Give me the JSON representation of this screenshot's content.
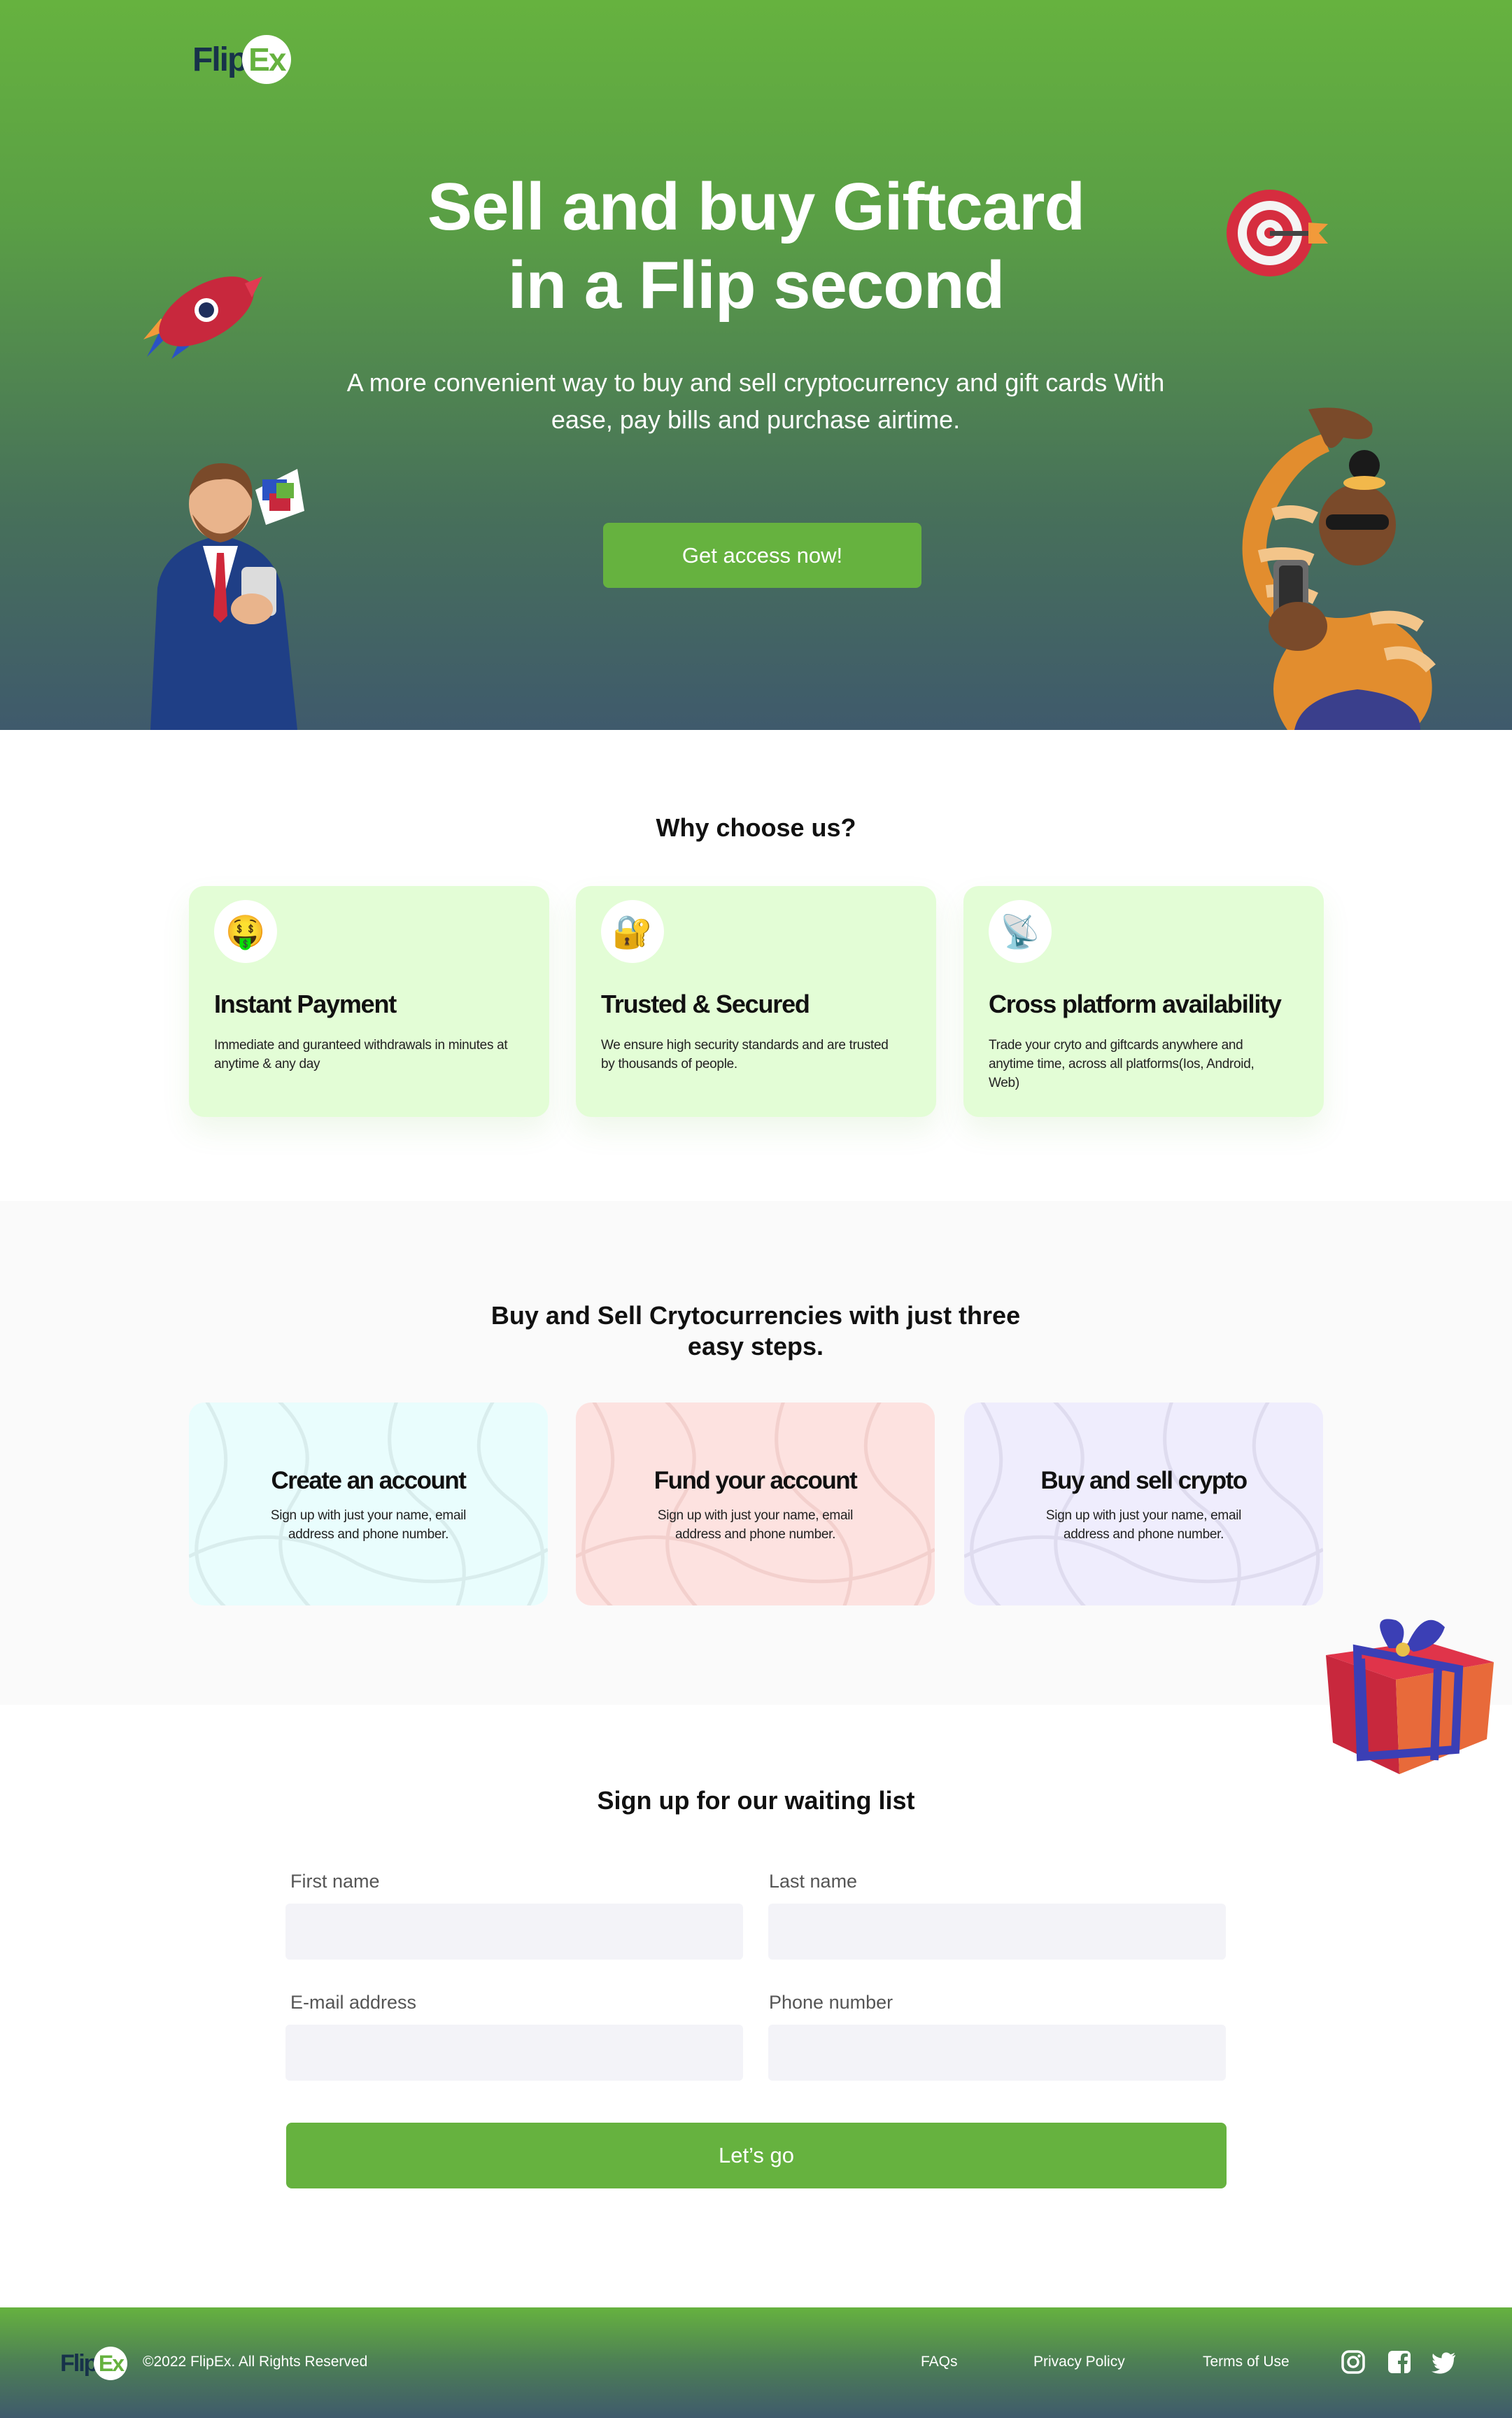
{
  "brand": {
    "name_part1": "Flip",
    "name_part2": "Ex"
  },
  "hero": {
    "title_line1": "Sell and buy Giftcard",
    "title_line2": "in a Flip second",
    "subtitle": "A more convenient way to buy and sell cryptocurrency and gift cards With ease, pay bills and purchase airtime.",
    "cta_label": "Get access now!"
  },
  "why": {
    "title": "Why choose us?",
    "features": [
      {
        "icon": "money-mouth-face-icon",
        "emoji": "🤑",
        "title": "Instant Payment",
        "text": "Immediate and guranteed withdrawals in minutes at anytime & any day"
      },
      {
        "icon": "lock-key-icon",
        "emoji": "🔐",
        "title": "Trusted & Secured",
        "text": "We ensure high security standards and are trusted by thousands of people."
      },
      {
        "icon": "satellite-dish-icon",
        "emoji": "📡",
        "title": "Cross platform availability",
        "text": "Trade your cryto and giftcards anywhere and anytime time, across all platforms(Ios, Android, Web)"
      }
    ]
  },
  "steps": {
    "title": "Buy and Sell Crytocurrencies with just three easy steps.",
    "items": [
      {
        "title": "Create an account",
        "text": "Sign up with just your name, email address and phone number.",
        "bg": "#e9fdfd"
      },
      {
        "title": "Fund your account",
        "text": "Sign up with just your name, email address and phone number.",
        "bg": "#fde2e0"
      },
      {
        "title": "Buy and sell crypto",
        "text": "Sign up with just your name, email address and phone number.",
        "bg": "#efedfd"
      }
    ]
  },
  "signup": {
    "title": "Sign up for our waiting list",
    "first_name_label": "First name",
    "last_name_label": "Last name",
    "email_label": "E-mail address",
    "phone_label": "Phone number",
    "first_name_value": "",
    "last_name_value": "",
    "email_value": "",
    "phone_value": "",
    "submit_label": "Let’s go"
  },
  "footer": {
    "copyright": "©2022 FlipEx. All Rights Reserved",
    "links": [
      "FAQs",
      "Privacy Policy",
      "Terms of Use"
    ],
    "social": [
      "instagram-icon",
      "facebook-icon",
      "twitter-icon"
    ]
  },
  "colors": {
    "brand_green": "#66b23f",
    "navy": "#17324a",
    "card_green": "#e3fdd6"
  }
}
